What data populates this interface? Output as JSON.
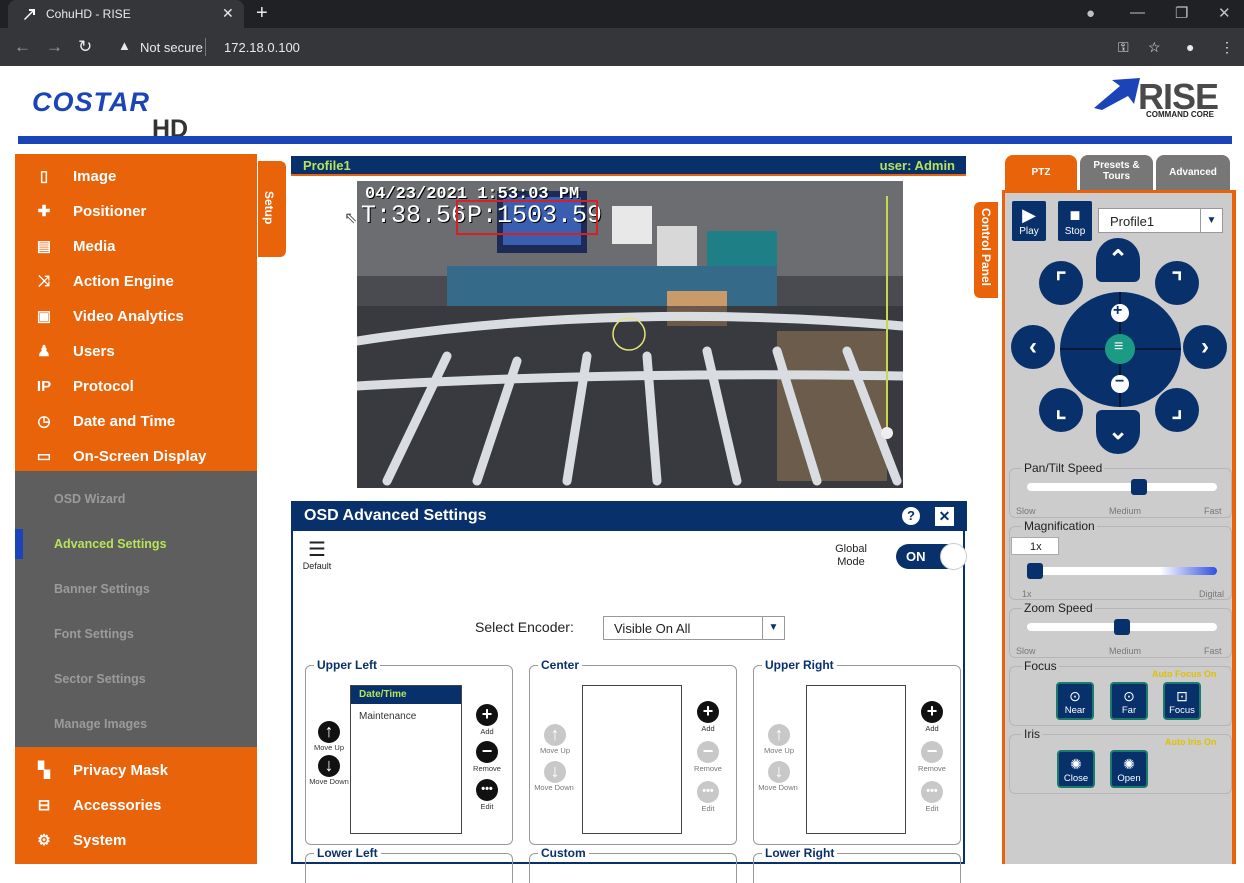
{
  "browser": {
    "tab_title": "CohuHD - RISE",
    "security": "Not secure",
    "url": "172.18.0.100",
    "new_tab": "+",
    "tab_close": "✕"
  },
  "header": {
    "brand_costar": "COSTAR",
    "brand_hd": "HD",
    "brand_rise": "RISE",
    "brand_rise_sub": "COMMAND CORE"
  },
  "sidebar": {
    "setup_tab": "Setup",
    "items": [
      {
        "label": "Image",
        "icon": "image-icon"
      },
      {
        "label": "Positioner",
        "icon": "positioner-icon"
      },
      {
        "label": "Media",
        "icon": "media-icon"
      },
      {
        "label": "Action Engine",
        "icon": "shuffle-icon"
      },
      {
        "label": "Video Analytics",
        "icon": "analytics-icon"
      },
      {
        "label": "Users",
        "icon": "user-icon"
      },
      {
        "label": "Protocol",
        "icon": "ip-icon"
      },
      {
        "label": "Date and Time",
        "icon": "clock-icon"
      },
      {
        "label": "On-Screen Display",
        "icon": "monitor-icon"
      }
    ],
    "subitems": [
      {
        "label": "OSD Wizard"
      },
      {
        "label": "Advanced Settings"
      },
      {
        "label": "Banner Settings"
      },
      {
        "label": "Font Settings"
      },
      {
        "label": "Sector Settings"
      },
      {
        "label": "Manage Images"
      }
    ],
    "items_bottom": [
      {
        "label": "Privacy Mask",
        "icon": "privacy-mask-icon"
      },
      {
        "label": "Accessories",
        "icon": "accessories-icon"
      },
      {
        "label": "System",
        "icon": "gear-icon"
      }
    ]
  },
  "video": {
    "profile": "Profile1",
    "user": "user: Admin",
    "osd_date": "04/23/2021 1:53:03 PM",
    "osd_tilt": "T:38.56",
    "osd_pan": "P:1503.59"
  },
  "osd_panel": {
    "title": "OSD Advanced Settings",
    "help": "?",
    "close": "✕",
    "default_label": "Default",
    "global_mode": "Global Mode",
    "toggle": "ON",
    "encoder_label": "Select Encoder:",
    "encoder_value": "Visible On All",
    "zones": [
      {
        "title": "Upper Left",
        "items": [
          "Date/Time",
          "Maintenance"
        ]
      },
      {
        "title": "Center",
        "items": []
      },
      {
        "title": "Upper Right",
        "items": []
      }
    ],
    "zones_bottom": [
      "Lower Left",
      "Custom",
      "Lower Right"
    ],
    "btn_move_up": "Move Up",
    "btn_move_down": "Move Down",
    "btn_add": "Add",
    "btn_remove": "Remove",
    "btn_edit": "Edit"
  },
  "control_panel": {
    "tab_label": "Control Panel",
    "tabs": [
      "PTZ",
      "Presets & Tours",
      "Advanced"
    ],
    "play": "Play",
    "stop": "Stop",
    "profile": "Profile1",
    "pan_tilt_speed": "Pan/Tilt Speed",
    "slow": "Slow",
    "medium": "Medium",
    "fast": "Fast",
    "magnification": "Magnification",
    "mag_value": "1x",
    "mag_min": "1x",
    "mag_max": "Digital",
    "zoom_speed": "Zoom Speed",
    "focus": "Focus",
    "auto_focus": "Auto Focus On",
    "near": "Near",
    "far": "Far",
    "focus_btn": "Focus",
    "iris": "Iris",
    "auto_iris": "Auto Iris On",
    "close": "Close",
    "open": "Open",
    "pan_tilt_level": 0.6,
    "zoom_speed_level": 0.5,
    "magnification_level": 0
  },
  "colors": {
    "orange": "#e8630a",
    "navy": "#08306b",
    "green": "#b6e45a",
    "blue": "#1a44b8"
  }
}
